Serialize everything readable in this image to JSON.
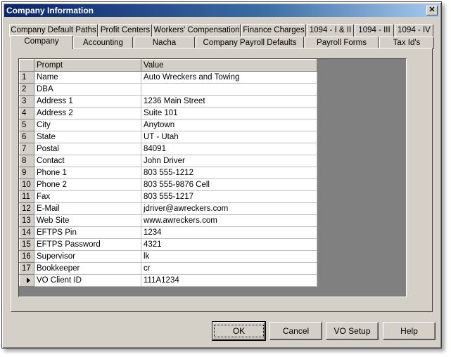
{
  "window": {
    "title": "Company Information",
    "close_glyph": "✕"
  },
  "tabs_row1": [
    {
      "label": "Company Default Paths"
    },
    {
      "label": "Profit Centers"
    },
    {
      "label": "Workers' Compensation"
    },
    {
      "label": "Finance Charges"
    },
    {
      "label": "1094 - I & II"
    },
    {
      "label": "1094 - III"
    },
    {
      "label": "1094 - IV"
    }
  ],
  "tabs_row2": [
    {
      "label": "Company"
    },
    {
      "label": "Accounting"
    },
    {
      "label": "Nacha"
    },
    {
      "label": "Company Payroll Defaults"
    },
    {
      "label": "Payroll Forms"
    },
    {
      "label": "Tax Id's"
    }
  ],
  "active_tab": "Company",
  "grid": {
    "columns": {
      "prompt": "Prompt",
      "value": "Value"
    },
    "rows": [
      {
        "num": "1",
        "prompt": "Name",
        "value": "Auto Wreckers and Towing"
      },
      {
        "num": "2",
        "prompt": "DBA",
        "value": ""
      },
      {
        "num": "3",
        "prompt": "Address 1",
        "value": "1236 Main Street"
      },
      {
        "num": "4",
        "prompt": "Address 2",
        "value": "Suite 101"
      },
      {
        "num": "5",
        "prompt": "City",
        "value": "Anytown"
      },
      {
        "num": "6",
        "prompt": "State",
        "value": "UT - Utah"
      },
      {
        "num": "7",
        "prompt": "Postal",
        "value": "84091"
      },
      {
        "num": "8",
        "prompt": "Contact",
        "value": "John Driver"
      },
      {
        "num": "9",
        "prompt": "Phone 1",
        "value": "803 555-1212"
      },
      {
        "num": "10",
        "prompt": "Phone 2",
        "value": "803 555-9876 Cell"
      },
      {
        "num": "11",
        "prompt": "Fax",
        "value": "803 555-1217"
      },
      {
        "num": "12",
        "prompt": "E-Mail",
        "value": "jdriver@awreckers.com"
      },
      {
        "num": "13",
        "prompt": "Web Site",
        "value": "www.awreckers.com"
      },
      {
        "num": "14",
        "prompt": "EFTPS Pin",
        "value": "1234"
      },
      {
        "num": "15",
        "prompt": "EFTPS Password",
        "value": "4321"
      },
      {
        "num": "16",
        "prompt": "Supervisor",
        "value": "lk"
      },
      {
        "num": "17",
        "prompt": "Bookkeeper",
        "value": "cr"
      }
    ],
    "current_row": {
      "prompt": "VO Client ID",
      "value": "111A1234"
    }
  },
  "buttons": {
    "ok": "OK",
    "cancel": "Cancel",
    "vo_setup": "VO Setup",
    "help": "Help"
  }
}
